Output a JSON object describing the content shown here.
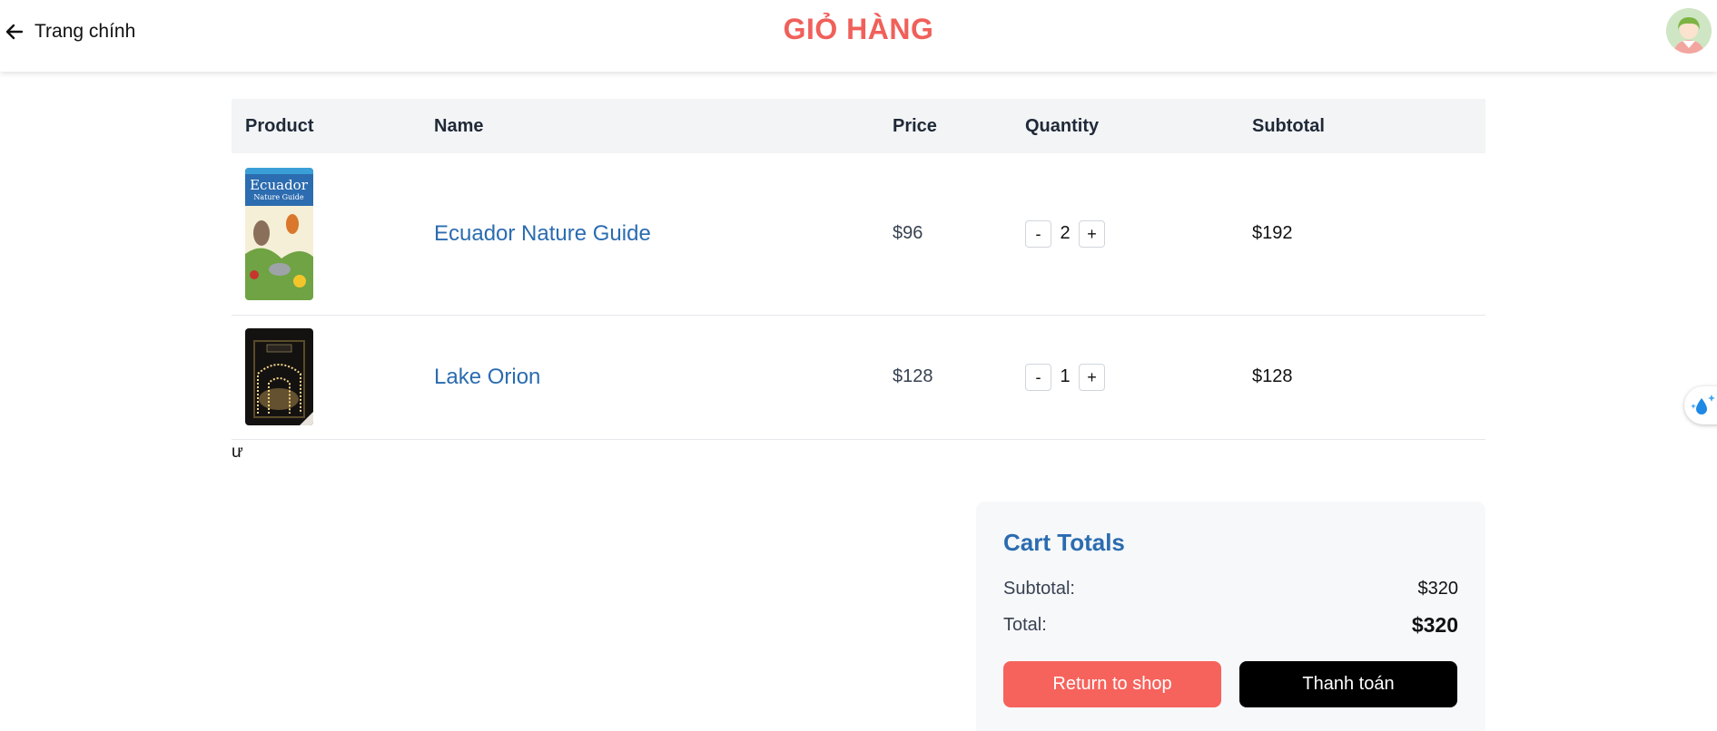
{
  "header": {
    "back_label": "Trang chính",
    "title": "GIỎ HÀNG"
  },
  "table": {
    "columns": [
      "Product",
      "Name",
      "Price",
      "Quantity",
      "Subtotal"
    ],
    "rows": [
      {
        "image_icon": "ecuador-book-cover",
        "name": "Ecuador Nature Guide",
        "price": "$96",
        "quantity": "2",
        "subtotal": "$192"
      },
      {
        "image_icon": "lake-orion-book-cover",
        "name": "Lake Orion",
        "price": "$128",
        "quantity": "1",
        "subtotal": "$128"
      }
    ],
    "minus_label": "-",
    "plus_label": "+"
  },
  "stray_text": "ư",
  "totals": {
    "title": "Cart Totals",
    "subtotal_label": "Subtotal:",
    "subtotal_value": "$320",
    "total_label": "Total:",
    "total_value": "$320",
    "return_label": "Return to shop",
    "checkout_label": "Thanh toán"
  },
  "colors": {
    "title": "#f0605a",
    "link": "#2b6cb0",
    "return_button": "#f6635c",
    "checkout_button": "#000000"
  }
}
